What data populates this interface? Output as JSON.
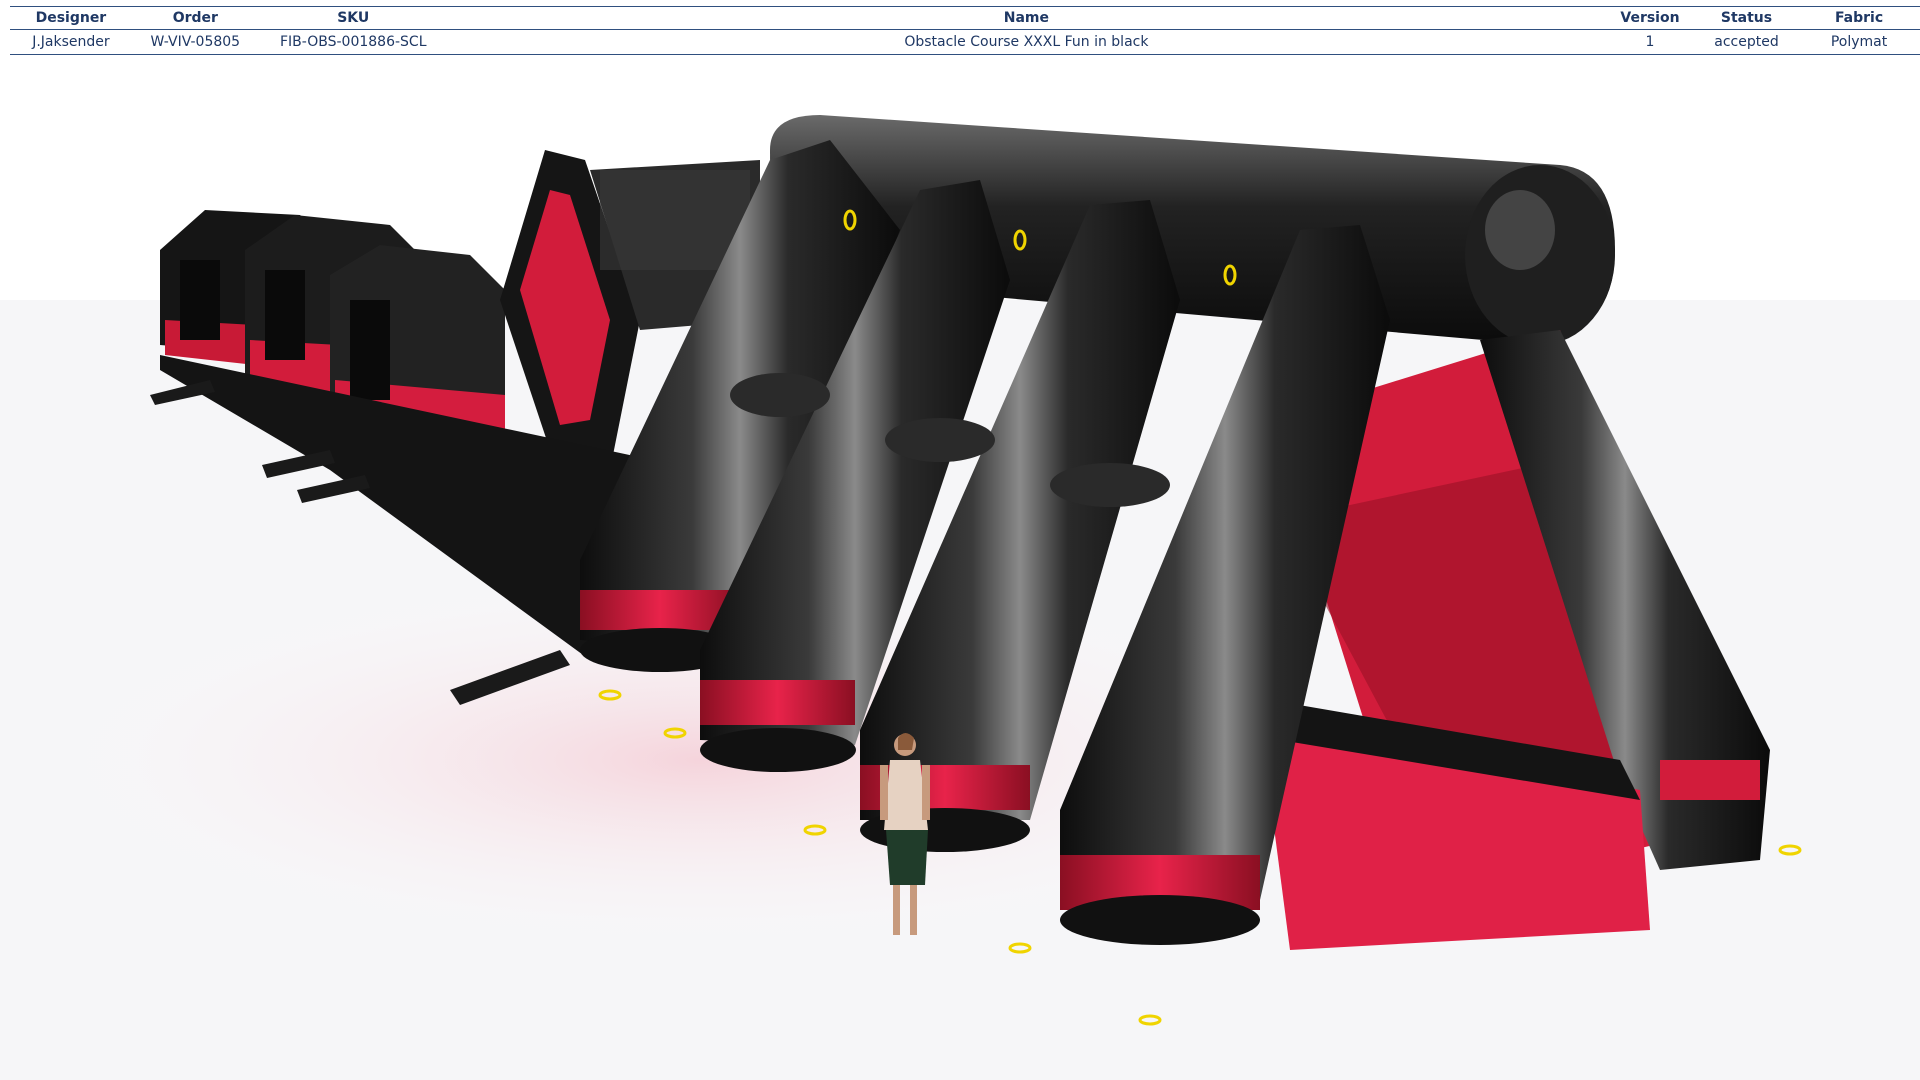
{
  "spec": {
    "headers": {
      "designer": "Designer",
      "order": "Order",
      "sku": "SKU",
      "name": "Name",
      "version": "Version",
      "status": "Status",
      "fabric": "Fabric"
    },
    "row": {
      "designer": "J.Jaksender",
      "order": "W-VIV-05805",
      "sku": "FIB-OBS-001886-SCL",
      "name": "Obstacle Course XXXL Fun in black",
      "version": "1",
      "status": "accepted",
      "fabric": "Polymat"
    }
  },
  "render": {
    "subject": "inflatable-obstacle-course",
    "colors": {
      "black": "#1a1a1a",
      "red": "#d81d3e",
      "yellow": "#f0d400",
      "floor": "#f3f3f5"
    }
  }
}
